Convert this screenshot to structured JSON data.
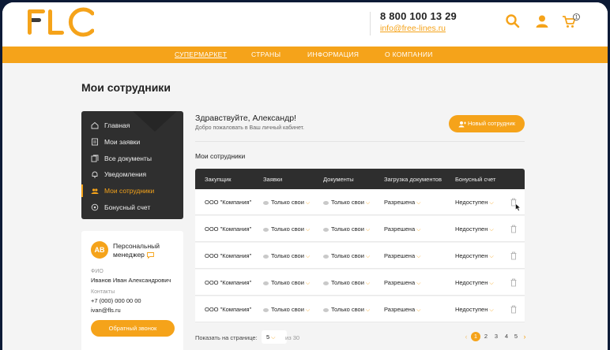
{
  "header": {
    "phone": "8 800 100 13 29",
    "email": "info@free-lines.ru",
    "cart_count": "1"
  },
  "nav": {
    "items": [
      "СУПЕРМАРКЕТ",
      "СТРАНЫ",
      "ИНФОРМАЦИЯ",
      "О КОМПАНИИ"
    ]
  },
  "page": {
    "title": "Мои сотрудники"
  },
  "sidebar": {
    "items": [
      {
        "label": "Главная",
        "icon": "home-icon"
      },
      {
        "label": "Мои заявки",
        "icon": "document-icon"
      },
      {
        "label": "Все документы",
        "icon": "documents-icon"
      },
      {
        "label": "Уведомления",
        "icon": "bell-icon"
      },
      {
        "label": "Мои сотрудники",
        "icon": "employees-icon"
      },
      {
        "label": "Бонусный счет",
        "icon": "bonus-icon"
      }
    ],
    "active_index": 4
  },
  "manager": {
    "initials": "АВ",
    "title": "Персональный менеджер",
    "fio_label": "ФИО",
    "fio": "Иванов Иван Александрович",
    "contacts_label": "Контакты",
    "phone": "+7 (000) 000 00 00",
    "email": "ivan@fls.ru",
    "callback_label": "Обратный звонок"
  },
  "main": {
    "greeting": "Здравствуйте, Александр!",
    "greeting_sub": "Добро пожаловать в Ваш личный кабинет.",
    "new_employee_label": "Новый сотрудник",
    "section_title": "Мои сотрудники"
  },
  "table": {
    "columns": [
      "Закупщик",
      "Заявки",
      "Документы",
      "Загрузка документов",
      "Бонусный счет"
    ],
    "rows": [
      {
        "buyer": "ООО \"Компания\"",
        "requests": "Только свои",
        "documents": "Только свои",
        "upload": "Разрешена",
        "bonus": "Недоступен"
      },
      {
        "buyer": "ООО \"Компания\"",
        "requests": "Только свои",
        "documents": "Только свои",
        "upload": "Разрешена",
        "bonus": "Недоступен"
      },
      {
        "buyer": "ООО \"Компания\"",
        "requests": "Только свои",
        "documents": "Только свои",
        "upload": "Разрешена",
        "bonus": "Недоступен"
      },
      {
        "buyer": "ООО \"Компания\"",
        "requests": "Только свои",
        "documents": "Только свои",
        "upload": "Разрешена",
        "bonus": "Недоступен"
      },
      {
        "buyer": "ООО \"Компания\"",
        "requests": "Только свои",
        "documents": "Только свои",
        "upload": "Разрешена",
        "bonus": "Недоступен"
      }
    ]
  },
  "pagination": {
    "per_page_label": "Показать на странице:",
    "per_page_value": "5",
    "of_label": "из 30",
    "pages": [
      "1",
      "2",
      "3",
      "4",
      "5"
    ],
    "active_page": "1"
  },
  "colors": {
    "accent": "#f5a31a",
    "dark": "#2e2e2e",
    "logo_dark": "#3b3b3b"
  }
}
